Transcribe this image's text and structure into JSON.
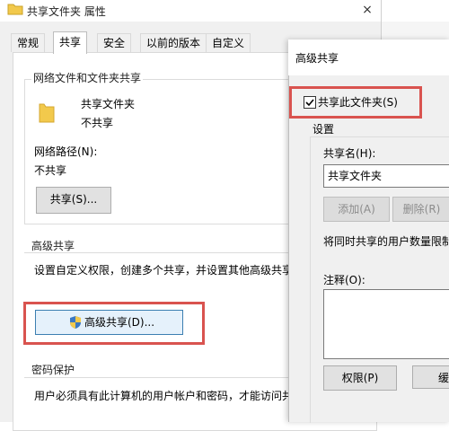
{
  "props_window": {
    "title": "共享文件夹 属性",
    "close_glyph": "×",
    "tabs": [
      "常规",
      "共享",
      "安全",
      "以前的版本",
      "自定义"
    ],
    "network_share_section": {
      "heading": "网络文件和文件夹共享",
      "folder_name": "共享文件夹",
      "share_state": "不共享",
      "network_path_label": "网络路径(N):",
      "network_path_value": "不共享",
      "share_button": "共享(S)..."
    },
    "advanced_section": {
      "heading": "高级共享",
      "description": "设置自定义权限，创建多个共享，并设置其他高级共享",
      "advanced_button": "高级共享(D)..."
    },
    "password_section": {
      "heading": "密码保护",
      "description": "用户必须具有此计算机的用户帐户和密码，才能访问共"
    }
  },
  "advanced_dialog": {
    "title": "高级共享",
    "share_checkbox_label": "共享此文件夹(S)",
    "share_checkbox_checked": true,
    "settings_label": "设置",
    "share_name_label": "共享名(H):",
    "share_name_value": "共享文件夹",
    "add_button": "添加(A)",
    "delete_button": "删除(R)",
    "limit_label": "将同时共享的用户数量限制",
    "comment_label": "注释(O):",
    "permissions_button": "权限(P)",
    "cache_button": "缓"
  },
  "colors": {
    "highlight": "#d9534f",
    "folder": "#f2c94c"
  }
}
